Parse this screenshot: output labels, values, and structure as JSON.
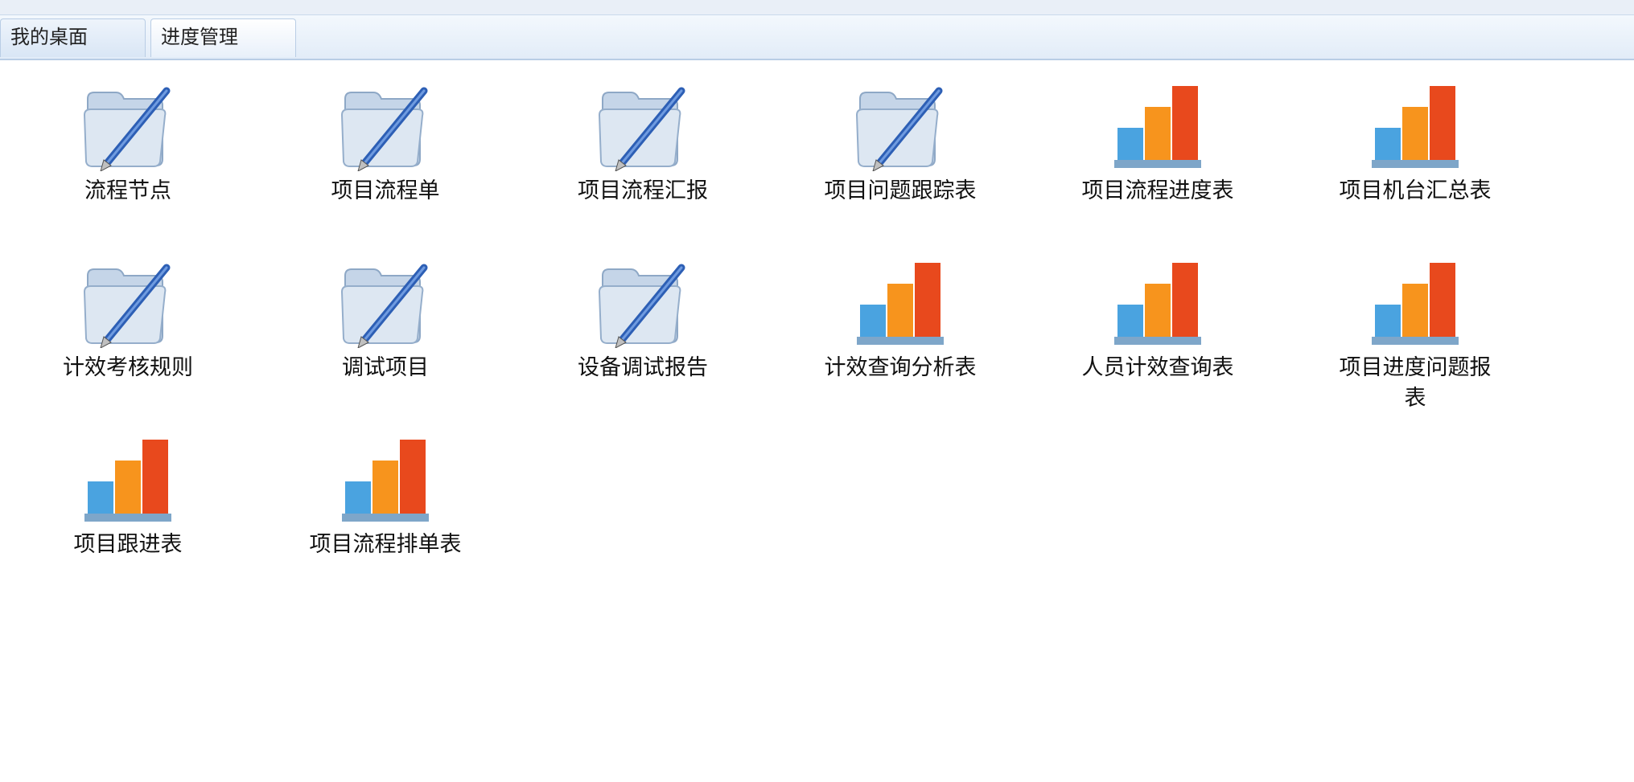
{
  "tabs": [
    {
      "label": "我的桌面"
    },
    {
      "label": "进度管理"
    }
  ],
  "desktop": {
    "items": [
      {
        "label": "流程节点",
        "icon": "folder-pen-icon"
      },
      {
        "label": "项目流程单",
        "icon": "folder-pen-icon"
      },
      {
        "label": "项目流程汇报",
        "icon": "folder-pen-icon"
      },
      {
        "label": "项目问题跟踪表",
        "icon": "folder-pen-icon"
      },
      {
        "label": "项目流程进度表",
        "icon": "bar-chart-icon"
      },
      {
        "label": "项目机台汇总表",
        "icon": "bar-chart-icon"
      },
      {
        "label": "计效考核规则",
        "icon": "folder-pen-icon"
      },
      {
        "label": "调试项目",
        "icon": "folder-pen-icon"
      },
      {
        "label": "设备调试报告",
        "icon": "folder-pen-icon"
      },
      {
        "label": "计效查询分析表",
        "icon": "bar-chart-icon"
      },
      {
        "label": "人员计效查询表",
        "icon": "bar-chart-icon"
      },
      {
        "label": "项目进度问题报表",
        "icon": "bar-chart-icon"
      },
      {
        "label": "项目跟进表",
        "icon": "bar-chart-icon"
      },
      {
        "label": "项目流程排单表",
        "icon": "bar-chart-icon"
      }
    ]
  },
  "colors": {
    "bar_blue": "#4aa3e0",
    "bar_orange": "#f7941d",
    "bar_red": "#e8491d",
    "folder": "#b9cbe0"
  }
}
